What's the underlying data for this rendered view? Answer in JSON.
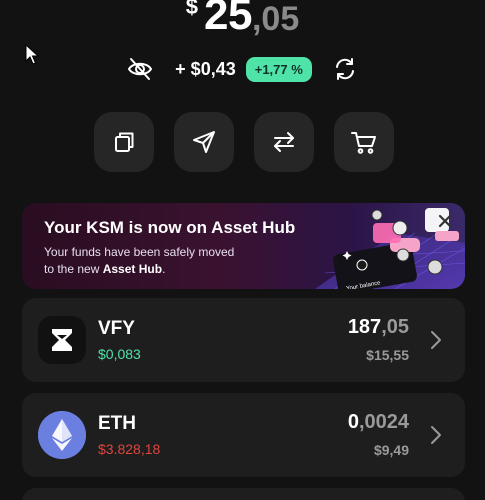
{
  "balance": {
    "currency_symbol": "$",
    "integer": "25",
    "decimal": ",05"
  },
  "change": {
    "amount": "+ $0,43",
    "percent": "+1,77 %",
    "percent_color": "#4fe3a8"
  },
  "actions": [
    {
      "icon": "copy-icon"
    },
    {
      "icon": "send-icon"
    },
    {
      "icon": "swap-icon"
    },
    {
      "icon": "cart-icon"
    }
  ],
  "banner": {
    "title": "Your KSM is now on Asset Hub",
    "subtitle_line1": "Your funds have been safely moved",
    "subtitle_prefix": "to the new ",
    "subtitle_bold": "Asset Hub",
    "subtitle_suffix": ".",
    "art_text": "Your balance"
  },
  "assets": [
    {
      "symbol": "VFY",
      "price": "$0,083",
      "price_color": "#4fe3a8",
      "amount_int": "187",
      "amount_dec": ",05",
      "value": "$15,55",
      "icon": "vfy-logo-icon"
    },
    {
      "symbol": "ETH",
      "price": "$3.828,18",
      "price_color": "#e0443e",
      "amount_int": "0",
      "amount_dec": ",0024",
      "value": "$9,49",
      "icon": "eth-logo-icon"
    }
  ]
}
